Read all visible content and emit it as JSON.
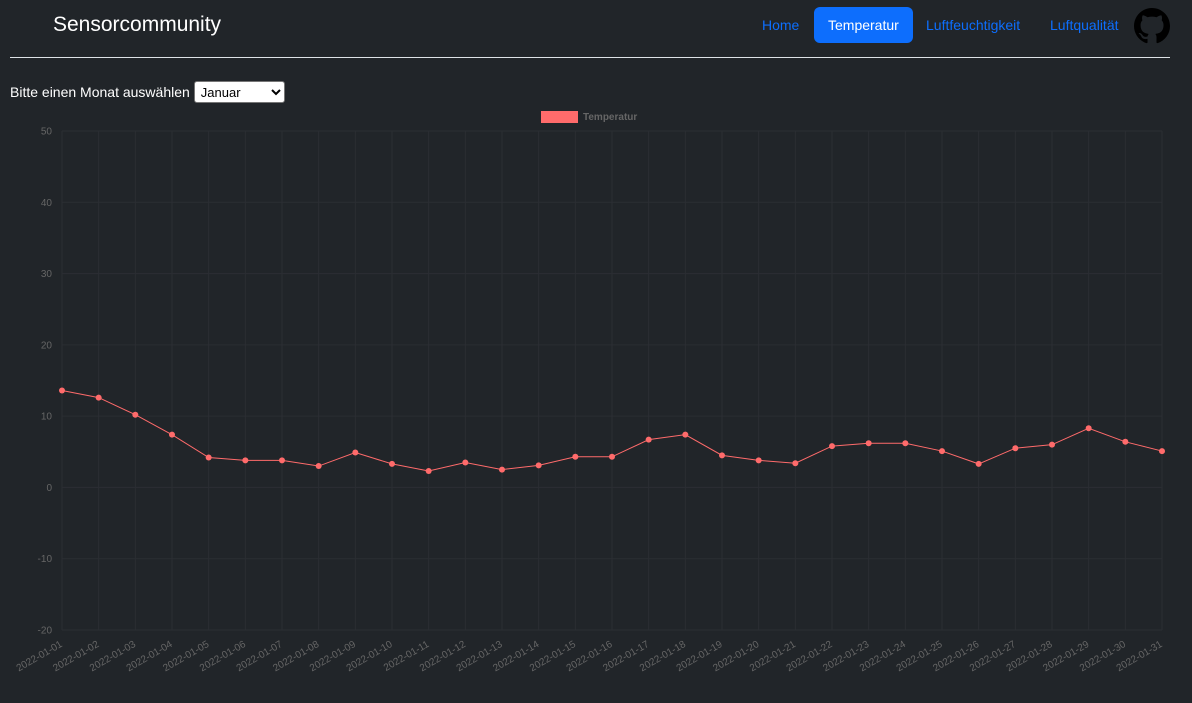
{
  "header": {
    "brand": "Sensorcommunity",
    "nav": [
      {
        "label": "Home",
        "active": false
      },
      {
        "label": "Temperatur",
        "active": true
      },
      {
        "label": "Luftfeuchtigkeit",
        "active": false
      },
      {
        "label": "Luftqualität",
        "active": false
      }
    ],
    "github_icon": "github-icon"
  },
  "month_selector": {
    "label": "Bitte einen Monat auswählen",
    "selected": "Januar"
  },
  "colors": {
    "background": "#212529",
    "accent": "#0d6efd",
    "series": "#ff6b6b"
  },
  "chart_data": {
    "type": "line",
    "title": "",
    "xlabel": "",
    "ylabel": "",
    "ylim": [
      -20,
      50
    ],
    "yticks": [
      50,
      40,
      30,
      20,
      10,
      0,
      -10,
      -20
    ],
    "legend_position": "top-center",
    "grid": true,
    "x": [
      "2022-01-01",
      "2022-01-02",
      "2022-01-03",
      "2022-01-04",
      "2022-01-05",
      "2022-01-06",
      "2022-01-07",
      "2022-01-08",
      "2022-01-09",
      "2022-01-10",
      "2022-01-11",
      "2022-01-12",
      "2022-01-13",
      "2022-01-14",
      "2022-01-15",
      "2022-01-16",
      "2022-01-17",
      "2022-01-18",
      "2022-01-19",
      "2022-01-20",
      "2022-01-21",
      "2022-01-22",
      "2022-01-23",
      "2022-01-24",
      "2022-01-25",
      "2022-01-26",
      "2022-01-27",
      "2022-01-28",
      "2022-01-29",
      "2022-01-30",
      "2022-01-31"
    ],
    "series": [
      {
        "name": "Temperatur",
        "values": [
          13.6,
          12.6,
          10.2,
          7.4,
          4.2,
          3.8,
          3.8,
          3.0,
          4.9,
          3.3,
          2.3,
          3.5,
          2.5,
          3.1,
          4.3,
          4.3,
          6.7,
          7.4,
          4.5,
          3.8,
          3.4,
          5.8,
          6.2,
          6.2,
          5.1,
          3.3,
          5.5,
          6.0,
          8.3,
          6.4,
          5.1
        ]
      }
    ]
  }
}
